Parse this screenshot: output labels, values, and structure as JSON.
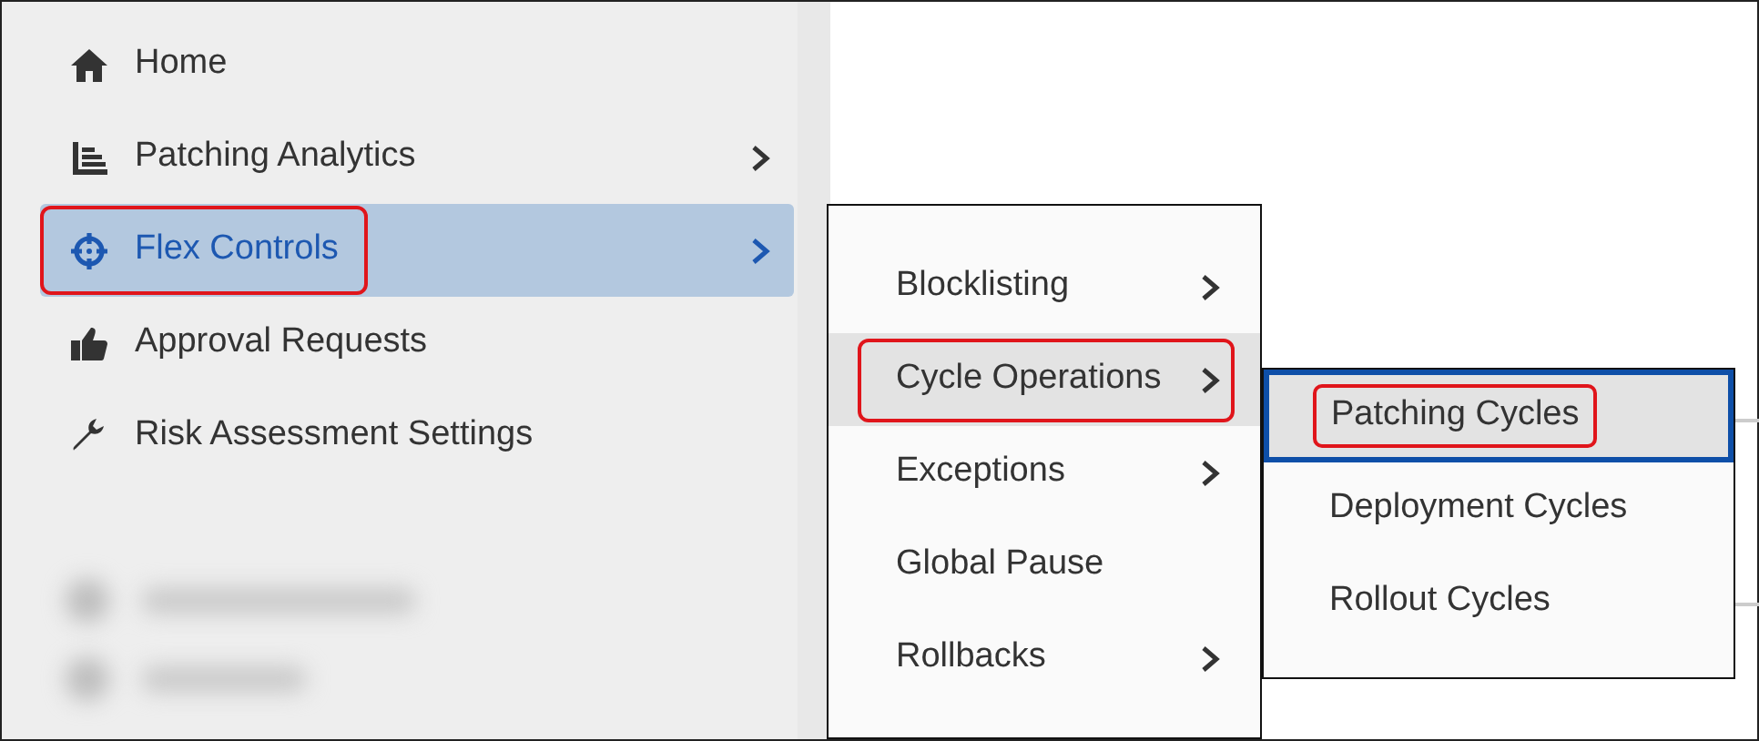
{
  "sidebar": {
    "items": [
      {
        "label": "Home",
        "submenu": false,
        "selected": false,
        "outlined": false
      },
      {
        "label": "Patching Analytics",
        "submenu": true,
        "selected": false,
        "outlined": false
      },
      {
        "label": "Flex Controls",
        "submenu": true,
        "selected": true,
        "outlined": true
      },
      {
        "label": "Approval Requests",
        "submenu": false,
        "selected": false,
        "outlined": false
      },
      {
        "label": "Risk Assessment Settings",
        "submenu": false,
        "selected": false,
        "outlined": false
      }
    ]
  },
  "flyout": {
    "items": [
      {
        "label": "Blocklisting",
        "submenu": true,
        "selected": false,
        "outlined": false
      },
      {
        "label": "Cycle Operations",
        "submenu": true,
        "selected": true,
        "outlined": true
      },
      {
        "label": "Exceptions",
        "submenu": true,
        "selected": false,
        "outlined": false
      },
      {
        "label": "Global Pause",
        "submenu": false,
        "selected": false,
        "outlined": false
      },
      {
        "label": "Rollbacks",
        "submenu": true,
        "selected": false,
        "outlined": false
      }
    ]
  },
  "submenu": {
    "items": [
      {
        "label": "Patching Cycles",
        "selected": true,
        "outlined": true
      },
      {
        "label": "Deployment Cycles",
        "selected": false,
        "outlined": false
      },
      {
        "label": "Rollout Cycles",
        "selected": false,
        "outlined": false
      }
    ]
  }
}
